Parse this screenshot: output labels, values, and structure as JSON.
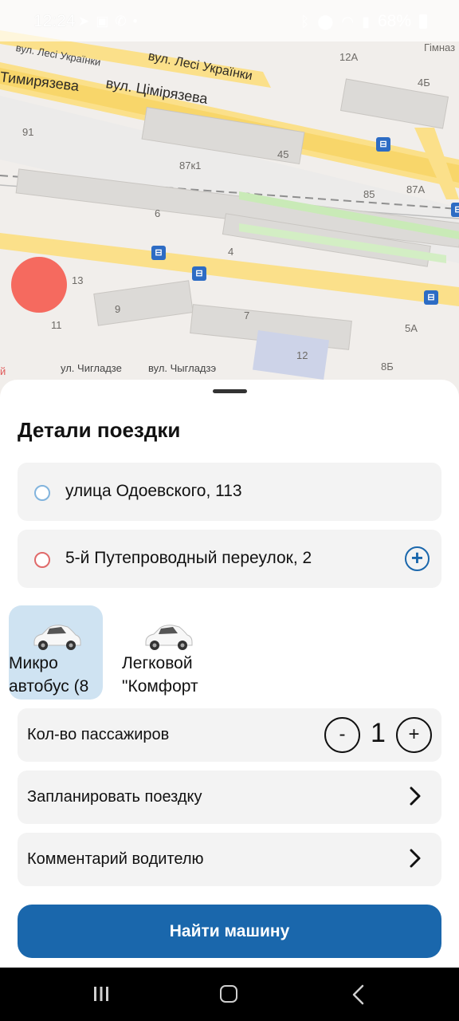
{
  "status_bar": {
    "time": "12:24",
    "battery": "68%",
    "left_icons": [
      "telegram-icon",
      "gamepad-icon",
      "viber-icon",
      "dot-icon"
    ],
    "right_icons": [
      "bluetooth-icon",
      "location-icon",
      "wifi-icon",
      "signal-icon",
      "battery-icon"
    ]
  },
  "map": {
    "streets": [
      "вул. Лесі Українки",
      "вул. Лесі Українки",
      "Тимирязева",
      "вул. Цімірязева",
      "ул. Чигладзе",
      "вул. Чыгладзэ"
    ],
    "labels": [
      "12А",
      "Гімназ",
      "4Б",
      "91",
      "45",
      "87к1",
      "85",
      "87А",
      "6",
      "4",
      "13",
      "9",
      "11",
      "7",
      "5А",
      "12",
      "8Б",
      "й"
    ]
  },
  "sheet": {
    "title": "Детали поездки",
    "from_address": "улица Одоевского, 113",
    "to_address": "5-й Путепроводный переулок, 2",
    "add_stop_label": "+",
    "car_options": [
      {
        "label_line1": "Микро",
        "label_line2": "автобус (8",
        "selected": true
      },
      {
        "label_line1": "Легковой",
        "label_line2": "\"Комфорт",
        "selected": false
      }
    ],
    "passengers_label": "Кол-во пассажиров",
    "passengers_minus": "-",
    "passengers_count": "1",
    "passengers_plus": "+",
    "schedule_label": "Запланировать поездку",
    "comment_label": "Комментарий водителю",
    "find_button": "Найти машину"
  },
  "colors": {
    "accent": "#1a67ac",
    "selected_car_bg": "#cfe3f2",
    "card_bg": "#f3f3f3",
    "location_dot": "#f56a5f"
  }
}
